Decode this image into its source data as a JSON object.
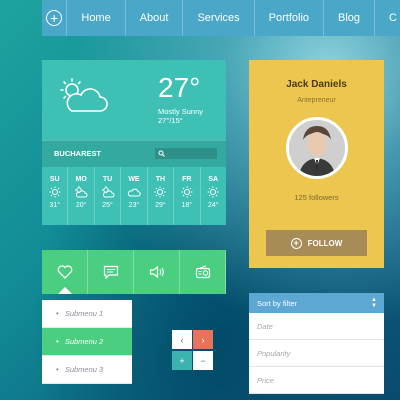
{
  "nav": {
    "items": [
      "Home",
      "About",
      "Services",
      "Portfolio",
      "Blog",
      "C"
    ]
  },
  "weather": {
    "temperature": "27°",
    "condition": "Mostly Sunny",
    "range": "27°/15°",
    "city": "BUCHAREST",
    "days": [
      {
        "name": "SU",
        "icon": "sun-icon",
        "temp": "31°"
      },
      {
        "name": "MO",
        "icon": "cloud-sun-icon",
        "temp": "20°"
      },
      {
        "name": "TU",
        "icon": "cloud-sun-icon",
        "temp": "25°"
      },
      {
        "name": "WE",
        "icon": "cloud-icon",
        "temp": "23°"
      },
      {
        "name": "TH",
        "icon": "sun-icon",
        "temp": "29°"
      },
      {
        "name": "FR",
        "icon": "sun-icon",
        "temp": "18°"
      },
      {
        "name": "SA",
        "icon": "sun-icon",
        "temp": "24°"
      }
    ]
  },
  "profile": {
    "name": "Jack Daniels",
    "role": "Antepreneur",
    "followers": "125 followers",
    "follow_label": "FOLLOW"
  },
  "toolbar": {
    "icons": [
      "heart-icon",
      "chat-icon",
      "speaker-icon",
      "radio-icon"
    ]
  },
  "submenu": {
    "items": [
      "Submenu 1",
      "Submenu 2",
      "Submenu 3"
    ],
    "active_index": 1
  },
  "filter": {
    "title": "Sort by filter",
    "rows": [
      "Date",
      "Popularity",
      "Price"
    ]
  },
  "colors": {
    "nav": "#4aa7c7",
    "weather": "#3fc0b4",
    "profile": "#ecc64f",
    "toolbar": "#4bce80",
    "follow": "#a88c57",
    "next_arrow": "#e8735b",
    "filter_header": "#5da7d3"
  }
}
